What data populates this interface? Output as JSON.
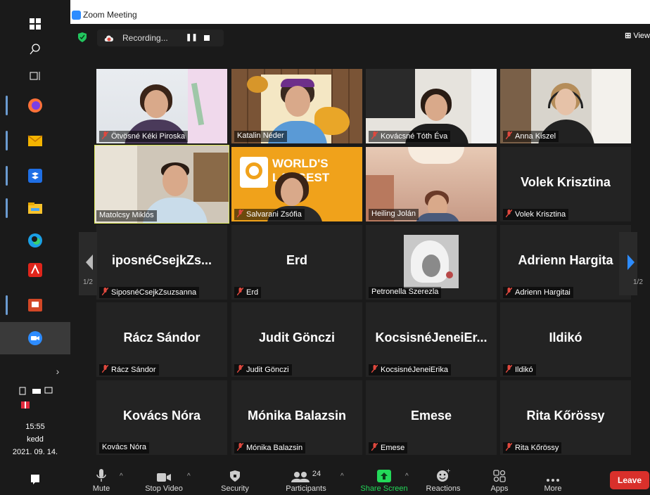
{
  "window": {
    "title": "Zoom Meeting"
  },
  "recording": {
    "label": "Recording...",
    "pause": "❚❚"
  },
  "view": {
    "label": "View"
  },
  "gallery": {
    "page": "1/2",
    "page_right": "1/2",
    "tiles": [
      {
        "label": "Ötvösné Kéki Piroska",
        "muted": true,
        "video": true
      },
      {
        "label": "Katalin Néder",
        "muted": false,
        "video": true
      },
      {
        "label": "Kovácsné Tóth Éva",
        "muted": true,
        "video": true
      },
      {
        "label": "Anna Kiszel",
        "muted": true,
        "video": true
      },
      {
        "label": "Matolcsy Miklós",
        "muted": false,
        "video": true,
        "active": true
      },
      {
        "label": "Salvarani Zsófia",
        "muted": true,
        "video": true,
        "banner1": "WORLD'S",
        "banner2": "LARGEST"
      },
      {
        "label": "Heiling Jolán",
        "muted": false,
        "video": true
      },
      {
        "label": "Volek Krisztina",
        "display": "Volek Krisztina",
        "muted": true,
        "video": false
      },
      {
        "label": "SiposnéCsejkZsuzsanna",
        "display": "iposnéCsejkZs...",
        "muted": true,
        "video": false
      },
      {
        "label": "Erd",
        "display": "Erd",
        "muted": true,
        "video": false
      },
      {
        "label": "Petronella Szerezla",
        "muted": false,
        "video": false,
        "avatar": true
      },
      {
        "label": "Adrienn Hargitai",
        "display": "Adrienn Hargita",
        "muted": true,
        "video": false
      },
      {
        "label": "Rácz Sándor",
        "display": "Rácz Sándor",
        "muted": true,
        "video": false
      },
      {
        "label": "Judit Gönczi",
        "display": "Judit Gönczi",
        "muted": true,
        "video": false
      },
      {
        "label": "KocsisnéJeneiErika",
        "display": "KocsisnéJeneiEr...",
        "muted": true,
        "video": false
      },
      {
        "label": "Ildikó",
        "display": "Ildikó",
        "muted": true,
        "video": false
      },
      {
        "label": "Kovács Nóra",
        "display": "Kovács Nóra",
        "muted": false,
        "video": false
      },
      {
        "label": "Mónika Balazsin",
        "display": "Mónika Balazsin",
        "muted": true,
        "video": false
      },
      {
        "label": "Emese",
        "display": "Emese",
        "muted": true,
        "video": false
      },
      {
        "label": "Rita  Kőrössy",
        "display": "Rita  Kőrössy",
        "muted": true,
        "video": false
      }
    ]
  },
  "toolbar": {
    "mute": "Mute",
    "stop_video": "Stop Video",
    "security": "Security",
    "participants": "Participants",
    "participants_count": "24",
    "share_screen": "Share Screen",
    "reactions": "Reactions",
    "apps": "Apps",
    "more": "More",
    "leave": "Leave"
  },
  "taskbar": {
    "time": "15:55",
    "day": "kedd",
    "date": "2021. 09. 14.",
    "expand": "›"
  },
  "colors": {
    "zoom_blue": "#2d8cff",
    "share_green": "#23d959",
    "leave_red": "#d9302b",
    "active_speaker": "#d9e45a",
    "mute_red": "#e0483e"
  }
}
